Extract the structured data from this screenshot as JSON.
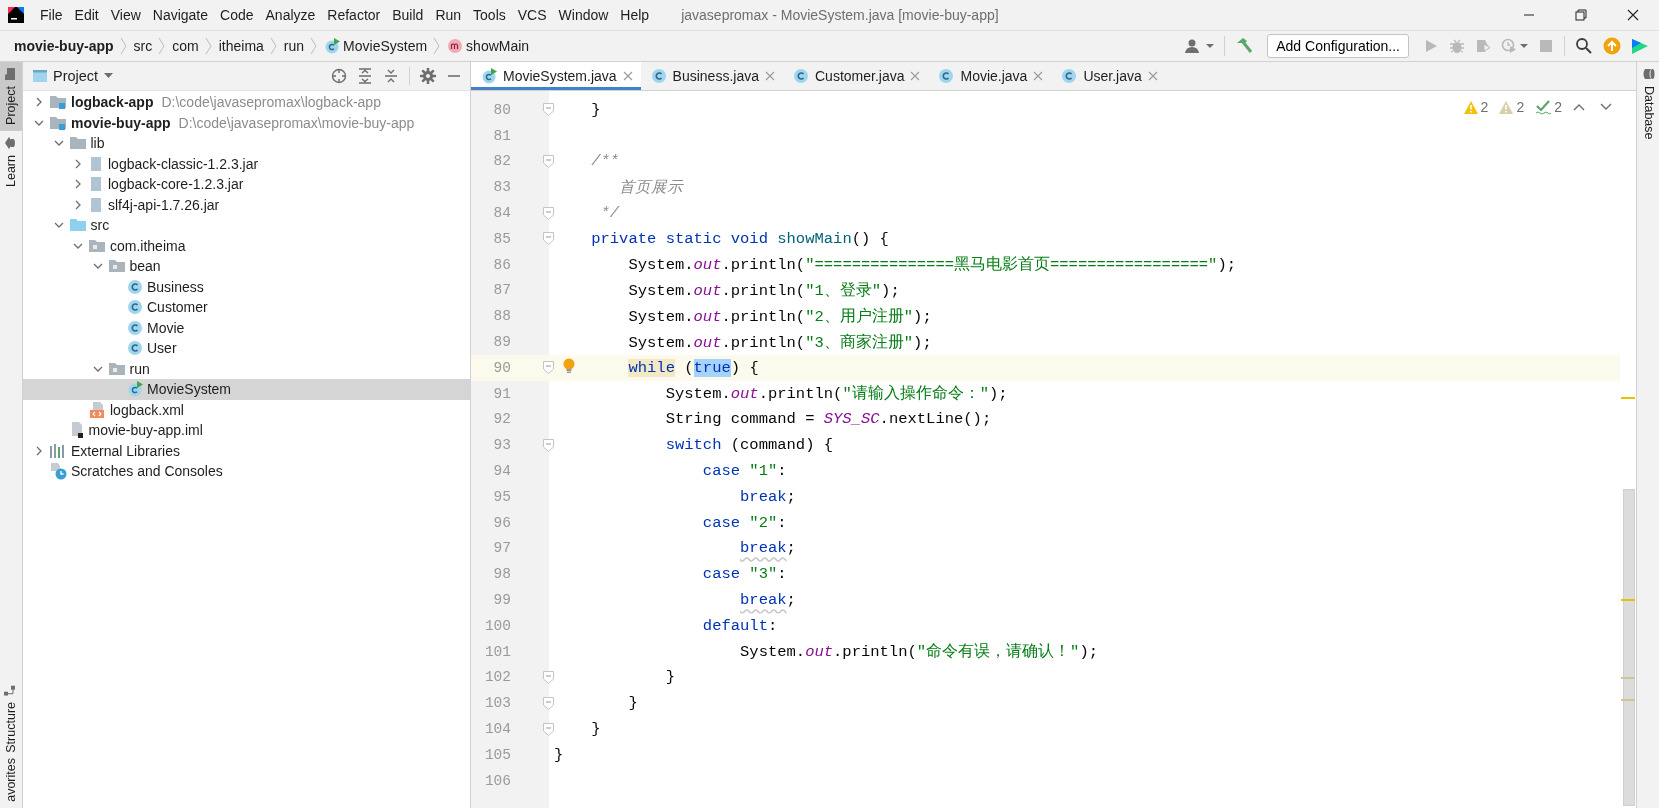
{
  "window": {
    "title": "javasepromax - MovieSystem.java [movie-buy-app]"
  },
  "menu": [
    "File",
    "Edit",
    "View",
    "Navigate",
    "Code",
    "Analyze",
    "Refactor",
    "Build",
    "Run",
    "Tools",
    "VCS",
    "Window",
    "Help"
  ],
  "breadcrumbs": [
    {
      "label": "movie-buy-app",
      "kind": "project"
    },
    {
      "label": "src",
      "kind": "dir"
    },
    {
      "label": "com",
      "kind": "dir"
    },
    {
      "label": "itheima",
      "kind": "dir"
    },
    {
      "label": "run",
      "kind": "dir"
    },
    {
      "label": "MovieSystem",
      "kind": "run-class"
    },
    {
      "label": "showMain",
      "kind": "method"
    }
  ],
  "toolbar": [
    {
      "kind": "user",
      "disabled": false
    },
    {
      "kind": "build",
      "disabled": false
    },
    {
      "kind": "configuration",
      "label": "Add Configuration..."
    },
    {
      "kind": "run",
      "disabled": true
    },
    {
      "kind": "debug",
      "disabled": true
    },
    {
      "kind": "coverage",
      "disabled": true
    },
    {
      "kind": "profile",
      "disabled": true
    },
    {
      "kind": "stop",
      "disabled": true
    },
    {
      "kind": "search",
      "disabled": false
    },
    {
      "kind": "update",
      "disabled": false
    },
    {
      "kind": "logo",
      "disabled": false
    }
  ],
  "left_tool_windows": [
    {
      "label": "Project",
      "kind": "project",
      "selected": true
    },
    {
      "label": "Learn",
      "kind": "learn",
      "selected": false
    }
  ],
  "left_bottom_tool_windows": [
    {
      "label": "Structure",
      "kind": "structure",
      "selected": false
    },
    {
      "label": "avorites",
      "kind": "favorites",
      "selected": false
    }
  ],
  "right_tool_windows": [
    {
      "label": "Database",
      "kind": "database",
      "selected": false
    }
  ],
  "project_panel": {
    "title": "Project",
    "tree": [
      {
        "label": "logback-app",
        "path": "D:\\code\\javasepromax\\logback-app",
        "kind": "module",
        "expanded": false,
        "selected": false
      },
      {
        "label": "movie-buy-app",
        "path": "D:\\code\\javasepromax\\movie-buy-app",
        "kind": "module",
        "expanded": true,
        "selected": false,
        "children": [
          {
            "label": "lib",
            "kind": "folder",
            "expanded": true,
            "selected": false,
            "children": [
              {
                "label": "logback-classic-1.2.3.jar",
                "kind": "jar",
                "expanded": false,
                "selected": false
              },
              {
                "label": "logback-core-1.2.3.jar",
                "kind": "jar",
                "expanded": false,
                "selected": false
              },
              {
                "label": "slf4j-api-1.7.26.jar",
                "kind": "jar",
                "expanded": false,
                "selected": false
              }
            ]
          },
          {
            "label": "src",
            "kind": "source-folder",
            "expanded": true,
            "selected": false,
            "children": [
              {
                "label": "com.itheima",
                "kind": "package",
                "expanded": true,
                "selected": false,
                "children": [
                  {
                    "label": "bean",
                    "kind": "package",
                    "expanded": true,
                    "selected": false,
                    "children": [
                      {
                        "label": "Business",
                        "kind": "class",
                        "selected": false
                      },
                      {
                        "label": "Customer",
                        "kind": "class",
                        "selected": false
                      },
                      {
                        "label": "Movie",
                        "kind": "class",
                        "selected": false
                      },
                      {
                        "label": "User",
                        "kind": "class",
                        "selected": false
                      }
                    ]
                  },
                  {
                    "label": "run",
                    "kind": "package",
                    "expanded": true,
                    "selected": false,
                    "children": [
                      {
                        "label": "MovieSystem",
                        "kind": "run-class",
                        "selected": true
                      }
                    ]
                  }
                ]
              },
              {
                "label": "logback.xml",
                "kind": "xml",
                "selected": false
              }
            ]
          },
          {
            "label": "movie-buy-app.iml",
            "kind": "iml",
            "selected": false
          }
        ]
      },
      {
        "label": "External Libraries",
        "kind": "libraries",
        "expanded": false,
        "selected": false
      },
      {
        "label": "Scratches and Consoles",
        "kind": "scratches",
        "selected": false
      }
    ]
  },
  "editor": {
    "tabs": [
      {
        "label": "MovieSystem.java",
        "kind": "run-class",
        "selected": true
      },
      {
        "label": "Business.java",
        "kind": "class",
        "selected": false
      },
      {
        "label": "Customer.java",
        "kind": "class",
        "selected": false
      },
      {
        "label": "Movie.java",
        "kind": "class",
        "selected": false
      },
      {
        "label": "User.java",
        "kind": "class",
        "selected": false
      }
    ],
    "inspections": [
      {
        "kind": "warning",
        "count": "2"
      },
      {
        "kind": "weak-warning",
        "count": "2"
      },
      {
        "kind": "typo",
        "count": "2"
      }
    ],
    "lines": [
      {
        "number": "80",
        "fold": true,
        "current": false,
        "bulb": false,
        "tokens": [
          {
            "kind": "plain",
            "text": "    }"
          }
        ]
      },
      {
        "number": "81",
        "fold": false,
        "current": false,
        "bulb": false
      },
      {
        "number": "82",
        "fold": true,
        "current": false,
        "bulb": false,
        "tokens": [
          {
            "kind": "comment",
            "text": "    /**"
          }
        ]
      },
      {
        "number": "83",
        "fold": false,
        "current": false,
        "bulb": false,
        "tokens": [
          {
            "kind": "comment",
            "text": "       首页展示"
          }
        ]
      },
      {
        "number": "84",
        "fold": true,
        "current": false,
        "bulb": false,
        "tokens": [
          {
            "kind": "comment",
            "text": "     */"
          }
        ]
      },
      {
        "number": "85",
        "fold": true,
        "current": false,
        "bulb": false,
        "tokens": [
          {
            "kind": "keyword",
            "text": "    private static void "
          },
          {
            "kind": "method",
            "text": "showMain"
          },
          {
            "kind": "plain",
            "text": "() {"
          }
        ]
      },
      {
        "number": "86",
        "fold": false,
        "current": false,
        "bulb": false,
        "tokens": [
          {
            "kind": "plain",
            "text": "        System."
          },
          {
            "kind": "field",
            "text": "out"
          },
          {
            "kind": "plain",
            "text": ".println("
          },
          {
            "kind": "string",
            "text": "\"===============黑马电影首页=================\""
          },
          {
            "kind": "plain",
            "text": ");"
          }
        ]
      },
      {
        "number": "87",
        "fold": false,
        "current": false,
        "bulb": false,
        "tokens": [
          {
            "kind": "plain",
            "text": "        System."
          },
          {
            "kind": "field",
            "text": "out"
          },
          {
            "kind": "plain",
            "text": ".println("
          },
          {
            "kind": "string",
            "text": "\"1、登录\""
          },
          {
            "kind": "plain",
            "text": ");"
          }
        ]
      },
      {
        "number": "88",
        "fold": false,
        "current": false,
        "bulb": false,
        "tokens": [
          {
            "kind": "plain",
            "text": "        System."
          },
          {
            "kind": "field",
            "text": "out"
          },
          {
            "kind": "plain",
            "text": ".println("
          },
          {
            "kind": "string",
            "text": "\"2、用户注册\""
          },
          {
            "kind": "plain",
            "text": ");"
          }
        ]
      },
      {
        "number": "89",
        "fold": false,
        "current": false,
        "bulb": false,
        "tokens": [
          {
            "kind": "plain",
            "text": "        System."
          },
          {
            "kind": "field",
            "text": "out"
          },
          {
            "kind": "plain",
            "text": ".println("
          },
          {
            "kind": "string",
            "text": "\"3、商家注册\""
          },
          {
            "kind": "plain",
            "text": ");"
          }
        ]
      },
      {
        "number": "90",
        "fold": true,
        "current": true,
        "bulb": true,
        "tokens": [
          {
            "kind": "keyword-match",
            "text": "        while"
          },
          {
            "kind": "plain",
            "text": " ("
          },
          {
            "kind": "keyword-selected",
            "text": "true"
          },
          {
            "kind": "plain",
            "text": ") {"
          }
        ]
      },
      {
        "number": "91",
        "fold": false,
        "current": false,
        "bulb": false,
        "tokens": [
          {
            "kind": "plain",
            "text": "            System."
          },
          {
            "kind": "field",
            "text": "out"
          },
          {
            "kind": "plain",
            "text": ".println("
          },
          {
            "kind": "string",
            "text": "\"请输入操作命令：\""
          },
          {
            "kind": "plain",
            "text": ");"
          }
        ]
      },
      {
        "number": "92",
        "fold": false,
        "current": false,
        "bulb": false,
        "tokens": [
          {
            "kind": "plain",
            "text": "            String command = "
          },
          {
            "kind": "field",
            "text": "SYS_SC"
          },
          {
            "kind": "plain",
            "text": ".nextLine();"
          }
        ]
      },
      {
        "number": "93",
        "fold": true,
        "current": false,
        "bulb": false,
        "tokens": [
          {
            "kind": "keyword",
            "text": "            switch"
          },
          {
            "kind": "plain",
            "text": " (command) {"
          }
        ]
      },
      {
        "number": "94",
        "fold": false,
        "current": false,
        "bulb": false,
        "tokens": [
          {
            "kind": "keyword",
            "text": "                case "
          },
          {
            "kind": "string",
            "text": "\"1\""
          },
          {
            "kind": "plain",
            "text": ":"
          }
        ]
      },
      {
        "number": "95",
        "fold": false,
        "current": false,
        "bulb": false,
        "tokens": [
          {
            "kind": "keyword",
            "text": "                    break"
          },
          {
            "kind": "plain",
            "text": ";"
          }
        ]
      },
      {
        "number": "96",
        "fold": false,
        "current": false,
        "bulb": false,
        "tokens": [
          {
            "kind": "keyword",
            "text": "                case "
          },
          {
            "kind": "string",
            "text": "\"2\""
          },
          {
            "kind": "plain",
            "text": ":"
          }
        ]
      },
      {
        "number": "97",
        "fold": false,
        "current": false,
        "bulb": false,
        "tokens": [
          {
            "kind": "keyword-warning",
            "text": "                    break"
          },
          {
            "kind": "plain",
            "text": ";"
          }
        ]
      },
      {
        "number": "98",
        "fold": false,
        "current": false,
        "bulb": false,
        "tokens": [
          {
            "kind": "keyword",
            "text": "                case "
          },
          {
            "kind": "string",
            "text": "\"3\""
          },
          {
            "kind": "plain",
            "text": ":"
          }
        ]
      },
      {
        "number": "99",
        "fold": false,
        "current": false,
        "bulb": false,
        "tokens": [
          {
            "kind": "keyword-warning",
            "text": "                    break"
          },
          {
            "kind": "plain",
            "text": ";"
          }
        ]
      },
      {
        "number": "100",
        "fold": false,
        "current": false,
        "bulb": false,
        "tokens": [
          {
            "kind": "keyword",
            "text": "                default"
          },
          {
            "kind": "plain",
            "text": ":"
          }
        ]
      },
      {
        "number": "101",
        "fold": false,
        "current": false,
        "bulb": false,
        "tokens": [
          {
            "kind": "plain",
            "text": "                    System."
          },
          {
            "kind": "field",
            "text": "out"
          },
          {
            "kind": "plain",
            "text": ".println("
          },
          {
            "kind": "string",
            "text": "\"命令有误，请确认！\""
          },
          {
            "kind": "plain",
            "text": ");"
          }
        ]
      },
      {
        "number": "102",
        "fold": true,
        "current": false,
        "bulb": false,
        "tokens": [
          {
            "kind": "plain",
            "text": "            }"
          }
        ]
      },
      {
        "number": "103",
        "fold": true,
        "current": false,
        "bulb": false,
        "tokens": [
          {
            "kind": "plain",
            "text": "        }"
          }
        ]
      },
      {
        "number": "104",
        "fold": true,
        "current": false,
        "bulb": false,
        "tokens": [
          {
            "kind": "plain",
            "text": "    }"
          }
        ]
      },
      {
        "number": "105",
        "fold": false,
        "current": false,
        "bulb": false,
        "tokens": [
          {
            "kind": "plain",
            "text": "}"
          }
        ]
      },
      {
        "number": "106",
        "fold": false,
        "current": false,
        "bulb": false
      }
    ]
  }
}
